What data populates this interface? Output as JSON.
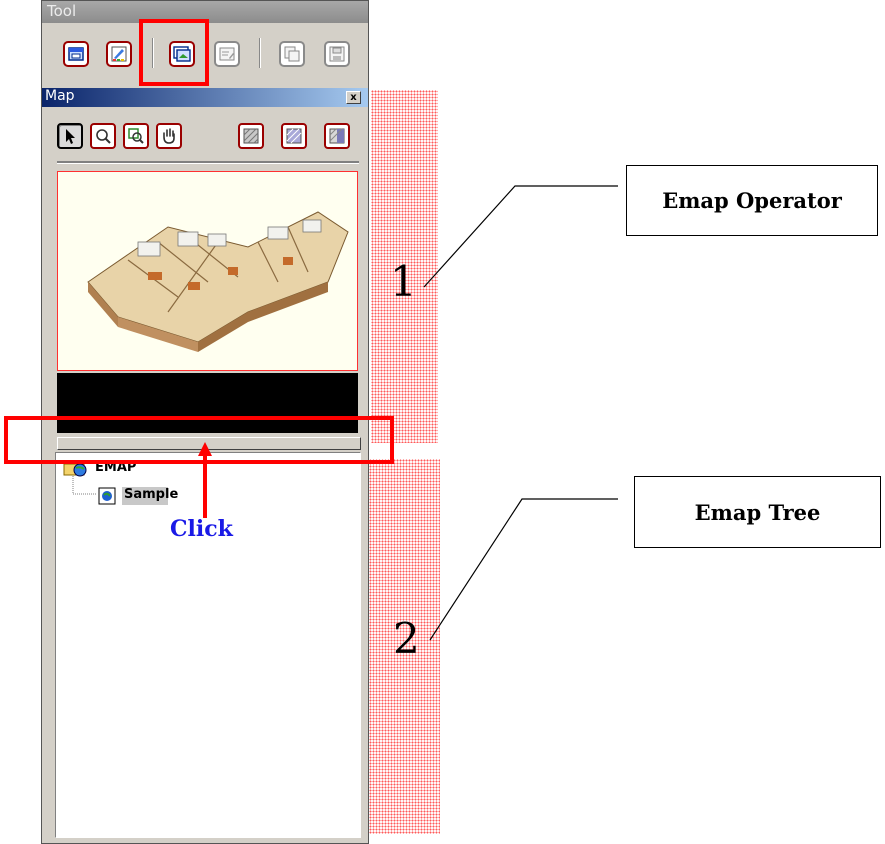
{
  "tool_window": {
    "title": "Tool",
    "buttons": [
      "open-window-icon",
      "edit-brush-icon",
      "map-window-icon",
      "properties-icon",
      "copy-icon",
      "save-icon"
    ]
  },
  "map_window": {
    "title": "Map",
    "close_glyph": "x",
    "toolbar": [
      "pointer-icon",
      "zoom-icon",
      "zoom-area-icon",
      "pan-hand-icon",
      "pattern-1-icon",
      "pattern-2-icon",
      "pattern-3-icon"
    ]
  },
  "tree": {
    "root": "EMAP",
    "child": "Sample"
  },
  "annotations": {
    "click_label": "Click",
    "region_1_number": "1",
    "region_2_number": "2",
    "callout_1": "Emap Operator",
    "callout_2": "Emap Tree"
  },
  "colors": {
    "highlight_red": "#ff0000",
    "click_blue": "#1a1ae6",
    "title_blue": "#0a246a",
    "button_border": "#9a0000"
  }
}
